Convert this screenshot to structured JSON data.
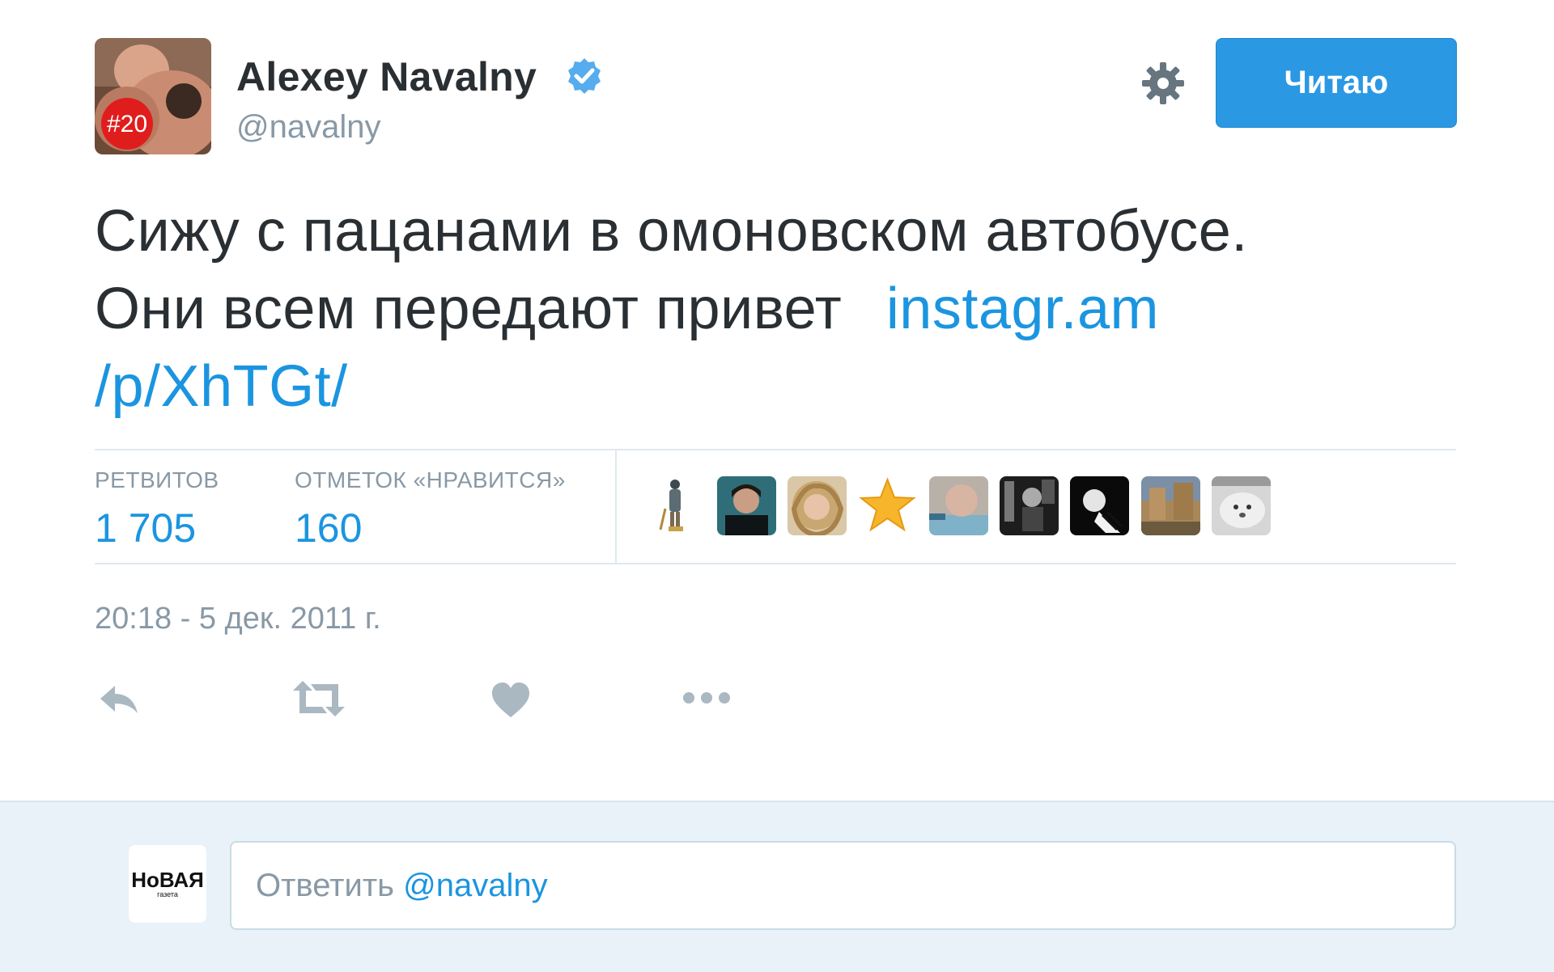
{
  "author": {
    "name": "Alexey Navalny",
    "handle": "@navalny",
    "avatar_badge": "#20"
  },
  "icons": {
    "verified": "verified-badge-icon",
    "settings": "gear-icon",
    "reply": "reply-icon",
    "retweet": "retweet-icon",
    "like": "heart-icon",
    "more": "more-dots-icon"
  },
  "follow_button": {
    "label": "Читаю"
  },
  "tweet": {
    "text_line1": "Сижу с пацанами в омоновском автобусе.",
    "text_line2": "Они всем передают привет",
    "link_part1": "instagr.am",
    "link_part2": "/p/XhTGt/"
  },
  "stats": {
    "retweets_label": "РЕТВИТОВ",
    "retweets_value": "1 705",
    "likes_label": "ОТМЕТОК «НРАВИТСЯ»",
    "likes_value": "160"
  },
  "timestamp": "20:18 - 5 дек. 2011 г.",
  "reply": {
    "placeholder": "Ответить ",
    "mention": "@navalny",
    "avatar_text_top": "НоВАЯ",
    "avatar_text_bottom": "газета"
  },
  "colors": {
    "accent": "#1b95e0",
    "follow_button": "#2b98e3",
    "muted": "#8899a6",
    "reply_bg": "#e8f2f8"
  }
}
